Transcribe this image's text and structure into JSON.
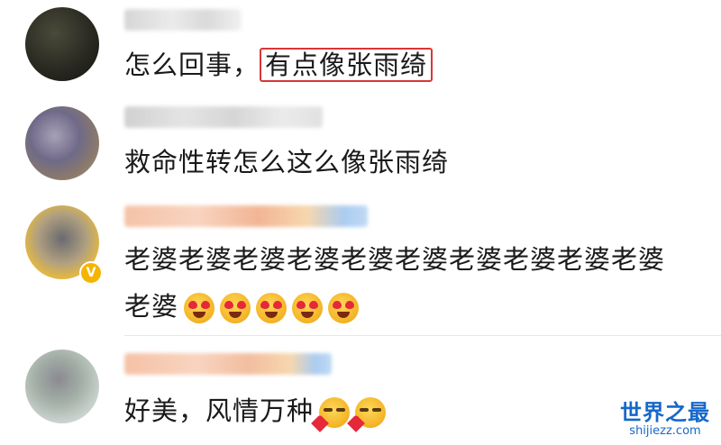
{
  "comments": [
    {
      "username": "",
      "text_before": "怎么回事，",
      "text_highlight": "有点像张雨绮",
      "text_after": ""
    },
    {
      "username": "",
      "text": "救命性转怎么这么像张雨绮"
    },
    {
      "username": "",
      "verified_badge": "V",
      "text": "老婆老婆老婆老婆老婆老婆老婆老婆老婆老婆老婆",
      "emojis": [
        "heart-eyes-icon",
        "heart-eyes-icon",
        "heart-eyes-icon",
        "heart-eyes-icon",
        "heart-eyes-icon"
      ]
    },
    {
      "username": "",
      "text": "好美，风情万种",
      "emojis": [
        "shy-heart-icon",
        "shy-heart-icon"
      ]
    }
  ],
  "watermark": {
    "main": "世界之最",
    "sub": "shijiezz.com"
  },
  "colors": {
    "highlight_border": "#d93636",
    "watermark": "#1668c9",
    "badge": "#f5b400"
  }
}
